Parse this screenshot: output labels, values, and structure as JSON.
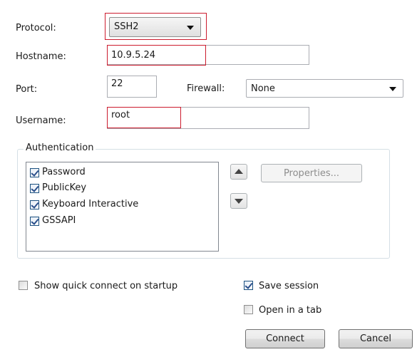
{
  "connection": {
    "protocol_label": "Protocol:",
    "protocol_value": "SSH2",
    "hostname_label": "Hostname:",
    "hostname_value": "10.9.5.24",
    "port_label": "Port:",
    "port_value": "22",
    "firewall_label": "Firewall:",
    "firewall_value": "None",
    "username_label": "Username:",
    "username_value": "root"
  },
  "authentication": {
    "group_label": "Authentication",
    "methods": [
      {
        "label": "Password",
        "checked": true
      },
      {
        "label": "PublicKey",
        "checked": true
      },
      {
        "label": "Keyboard Interactive",
        "checked": true
      },
      {
        "label": "GSSAPI",
        "checked": true
      }
    ],
    "properties_button": "Properties...",
    "move_up_icon": "triangle-up-icon",
    "move_down_icon": "triangle-down-icon"
  },
  "options": {
    "show_quick_connect": {
      "label": "Show quick connect on startup",
      "checked": false
    },
    "save_session": {
      "label": "Save session",
      "checked": true
    },
    "open_in_tab": {
      "label": "Open in a tab",
      "checked": false
    }
  },
  "buttons": {
    "connect": "Connect",
    "cancel": "Cancel"
  },
  "colors": {
    "highlight": "#cc1c2e",
    "group_border": "#d5dfe5"
  }
}
